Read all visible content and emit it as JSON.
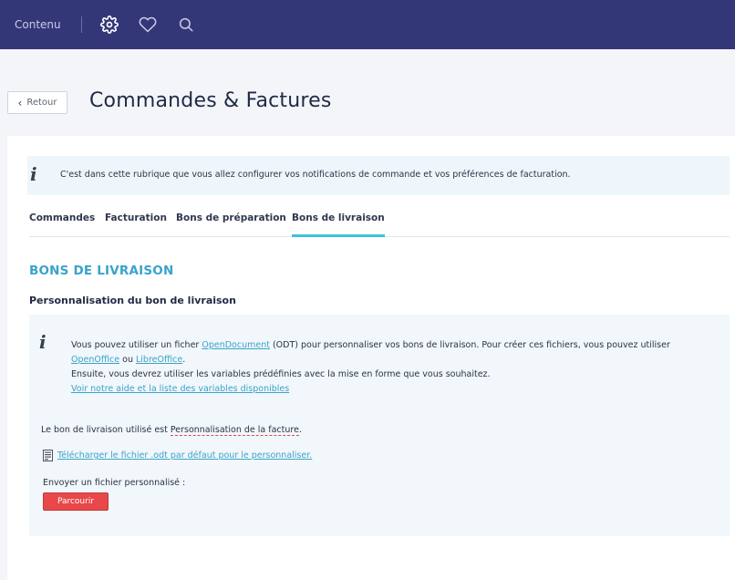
{
  "topbar": {
    "brand": "Contenu",
    "icons": [
      "gear-icon",
      "heart-icon",
      "search-icon"
    ],
    "bg_color": "#343777"
  },
  "header": {
    "back_label": "Retour",
    "title": "Commandes & Factures"
  },
  "info_banner": {
    "text": "C'est dans cette rubrique que vous allez configurer vos notifications de commande et vos préférences de facturation."
  },
  "tabs": [
    {
      "label": "Commandes",
      "active": false
    },
    {
      "label": "Facturation",
      "active": false
    },
    {
      "label": "Bons de préparation",
      "active": false
    },
    {
      "label": "Bons de livraison",
      "active": true
    }
  ],
  "section": {
    "title": "BONS DE LIVRAISON",
    "subtitle": "Personnalisation du bon de livraison"
  },
  "help": {
    "line1_a": "Vous pouvez utiliser un ficher ",
    "link_odt": "OpenDocument",
    "line1_b": " (ODT) pour personnaliser vos bons de livraison. Pour créer ces fichiers, vous pouvez utiliser ",
    "link_openoffice": "OpenOffice",
    "or": " ou ",
    "link_libreoffice": "LibreOffice",
    "dot": ".",
    "line2": "Ensuite, vous devrez utiliser les variables prédéfinies avec la mise en forme que vous souhaitez.",
    "help_link": "Voir notre aide et la liste des variables disponibles"
  },
  "current": {
    "prefix": "Le bon de livraison utilisé est ",
    "value": "Personnalisation de la facture",
    "suffix": "."
  },
  "download": {
    "label": "Télécharger le fichier .odt par défaut pour le personnaliser."
  },
  "upload": {
    "label": "Envoyer un fichier personnalisé :",
    "button": "Parcourir"
  },
  "colors": {
    "accent": "#3aa3cb",
    "tab_underline": "#3cc3e0",
    "button_red": "#e8484a"
  }
}
